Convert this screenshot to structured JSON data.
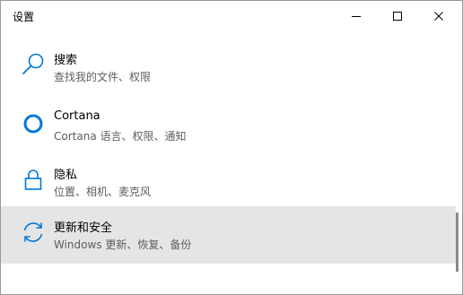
{
  "window": {
    "title": "设置",
    "accent_color": "#0078d7",
    "selected_background": "#e5e5e5"
  },
  "controls": {
    "minimize_icon": "minimize-icon",
    "maximize_icon": "maximize-icon",
    "close_icon": "close-icon"
  },
  "items": [
    {
      "icon": "search-icon",
      "label": "搜索",
      "description": "查找我的文件、权限"
    },
    {
      "icon": "cortana-icon",
      "label": "Cortana",
      "description": "Cortana 语言、权限、通知"
    },
    {
      "icon": "lock-icon",
      "label": "隐私",
      "description": "位置、相机、麦克风"
    },
    {
      "icon": "sync-icon",
      "label": "更新和安全",
      "description": "Windows 更新、恢复、备份",
      "selected": true
    }
  ]
}
